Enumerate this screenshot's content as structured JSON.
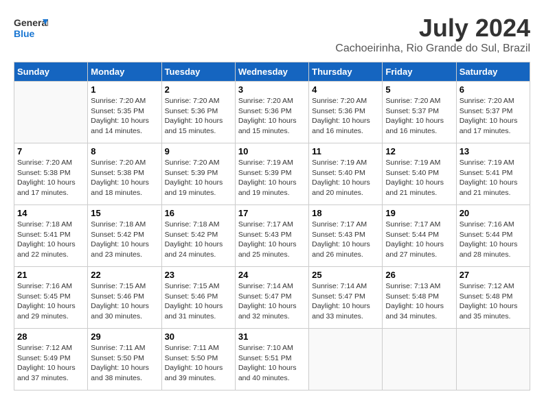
{
  "header": {
    "logo_general": "General",
    "logo_blue": "Blue",
    "month": "July 2024",
    "location": "Cachoeirinha, Rio Grande do Sul, Brazil"
  },
  "days_of_week": [
    "Sunday",
    "Monday",
    "Tuesday",
    "Wednesday",
    "Thursday",
    "Friday",
    "Saturday"
  ],
  "weeks": [
    [
      {
        "day": "",
        "sunrise": "",
        "sunset": "",
        "daylight": ""
      },
      {
        "day": "1",
        "sunrise": "Sunrise: 7:20 AM",
        "sunset": "Sunset: 5:35 PM",
        "daylight": "Daylight: 10 hours and 14 minutes."
      },
      {
        "day": "2",
        "sunrise": "Sunrise: 7:20 AM",
        "sunset": "Sunset: 5:36 PM",
        "daylight": "Daylight: 10 hours and 15 minutes."
      },
      {
        "day": "3",
        "sunrise": "Sunrise: 7:20 AM",
        "sunset": "Sunset: 5:36 PM",
        "daylight": "Daylight: 10 hours and 15 minutes."
      },
      {
        "day": "4",
        "sunrise": "Sunrise: 7:20 AM",
        "sunset": "Sunset: 5:36 PM",
        "daylight": "Daylight: 10 hours and 16 minutes."
      },
      {
        "day": "5",
        "sunrise": "Sunrise: 7:20 AM",
        "sunset": "Sunset: 5:37 PM",
        "daylight": "Daylight: 10 hours and 16 minutes."
      },
      {
        "day": "6",
        "sunrise": "Sunrise: 7:20 AM",
        "sunset": "Sunset: 5:37 PM",
        "daylight": "Daylight: 10 hours and 17 minutes."
      }
    ],
    [
      {
        "day": "7",
        "sunrise": "Sunrise: 7:20 AM",
        "sunset": "Sunset: 5:38 PM",
        "daylight": "Daylight: 10 hours and 17 minutes."
      },
      {
        "day": "8",
        "sunrise": "Sunrise: 7:20 AM",
        "sunset": "Sunset: 5:38 PM",
        "daylight": "Daylight: 10 hours and 18 minutes."
      },
      {
        "day": "9",
        "sunrise": "Sunrise: 7:20 AM",
        "sunset": "Sunset: 5:39 PM",
        "daylight": "Daylight: 10 hours and 19 minutes."
      },
      {
        "day": "10",
        "sunrise": "Sunrise: 7:19 AM",
        "sunset": "Sunset: 5:39 PM",
        "daylight": "Daylight: 10 hours and 19 minutes."
      },
      {
        "day": "11",
        "sunrise": "Sunrise: 7:19 AM",
        "sunset": "Sunset: 5:40 PM",
        "daylight": "Daylight: 10 hours and 20 minutes."
      },
      {
        "day": "12",
        "sunrise": "Sunrise: 7:19 AM",
        "sunset": "Sunset: 5:40 PM",
        "daylight": "Daylight: 10 hours and 21 minutes."
      },
      {
        "day": "13",
        "sunrise": "Sunrise: 7:19 AM",
        "sunset": "Sunset: 5:41 PM",
        "daylight": "Daylight: 10 hours and 21 minutes."
      }
    ],
    [
      {
        "day": "14",
        "sunrise": "Sunrise: 7:18 AM",
        "sunset": "Sunset: 5:41 PM",
        "daylight": "Daylight: 10 hours and 22 minutes."
      },
      {
        "day": "15",
        "sunrise": "Sunrise: 7:18 AM",
        "sunset": "Sunset: 5:42 PM",
        "daylight": "Daylight: 10 hours and 23 minutes."
      },
      {
        "day": "16",
        "sunrise": "Sunrise: 7:18 AM",
        "sunset": "Sunset: 5:42 PM",
        "daylight": "Daylight: 10 hours and 24 minutes."
      },
      {
        "day": "17",
        "sunrise": "Sunrise: 7:17 AM",
        "sunset": "Sunset: 5:43 PM",
        "daylight": "Daylight: 10 hours and 25 minutes."
      },
      {
        "day": "18",
        "sunrise": "Sunrise: 7:17 AM",
        "sunset": "Sunset: 5:43 PM",
        "daylight": "Daylight: 10 hours and 26 minutes."
      },
      {
        "day": "19",
        "sunrise": "Sunrise: 7:17 AM",
        "sunset": "Sunset: 5:44 PM",
        "daylight": "Daylight: 10 hours and 27 minutes."
      },
      {
        "day": "20",
        "sunrise": "Sunrise: 7:16 AM",
        "sunset": "Sunset: 5:44 PM",
        "daylight": "Daylight: 10 hours and 28 minutes."
      }
    ],
    [
      {
        "day": "21",
        "sunrise": "Sunrise: 7:16 AM",
        "sunset": "Sunset: 5:45 PM",
        "daylight": "Daylight: 10 hours and 29 minutes."
      },
      {
        "day": "22",
        "sunrise": "Sunrise: 7:15 AM",
        "sunset": "Sunset: 5:46 PM",
        "daylight": "Daylight: 10 hours and 30 minutes."
      },
      {
        "day": "23",
        "sunrise": "Sunrise: 7:15 AM",
        "sunset": "Sunset: 5:46 PM",
        "daylight": "Daylight: 10 hours and 31 minutes."
      },
      {
        "day": "24",
        "sunrise": "Sunrise: 7:14 AM",
        "sunset": "Sunset: 5:47 PM",
        "daylight": "Daylight: 10 hours and 32 minutes."
      },
      {
        "day": "25",
        "sunrise": "Sunrise: 7:14 AM",
        "sunset": "Sunset: 5:47 PM",
        "daylight": "Daylight: 10 hours and 33 minutes."
      },
      {
        "day": "26",
        "sunrise": "Sunrise: 7:13 AM",
        "sunset": "Sunset: 5:48 PM",
        "daylight": "Daylight: 10 hours and 34 minutes."
      },
      {
        "day": "27",
        "sunrise": "Sunrise: 7:12 AM",
        "sunset": "Sunset: 5:48 PM",
        "daylight": "Daylight: 10 hours and 35 minutes."
      }
    ],
    [
      {
        "day": "28",
        "sunrise": "Sunrise: 7:12 AM",
        "sunset": "Sunset: 5:49 PM",
        "daylight": "Daylight: 10 hours and 37 minutes."
      },
      {
        "day": "29",
        "sunrise": "Sunrise: 7:11 AM",
        "sunset": "Sunset: 5:50 PM",
        "daylight": "Daylight: 10 hours and 38 minutes."
      },
      {
        "day": "30",
        "sunrise": "Sunrise: 7:11 AM",
        "sunset": "Sunset: 5:50 PM",
        "daylight": "Daylight: 10 hours and 39 minutes."
      },
      {
        "day": "31",
        "sunrise": "Sunrise: 7:10 AM",
        "sunset": "Sunset: 5:51 PM",
        "daylight": "Daylight: 10 hours and 40 minutes."
      },
      {
        "day": "",
        "sunrise": "",
        "sunset": "",
        "daylight": ""
      },
      {
        "day": "",
        "sunrise": "",
        "sunset": "",
        "daylight": ""
      },
      {
        "day": "",
        "sunrise": "",
        "sunset": "",
        "daylight": ""
      }
    ]
  ]
}
